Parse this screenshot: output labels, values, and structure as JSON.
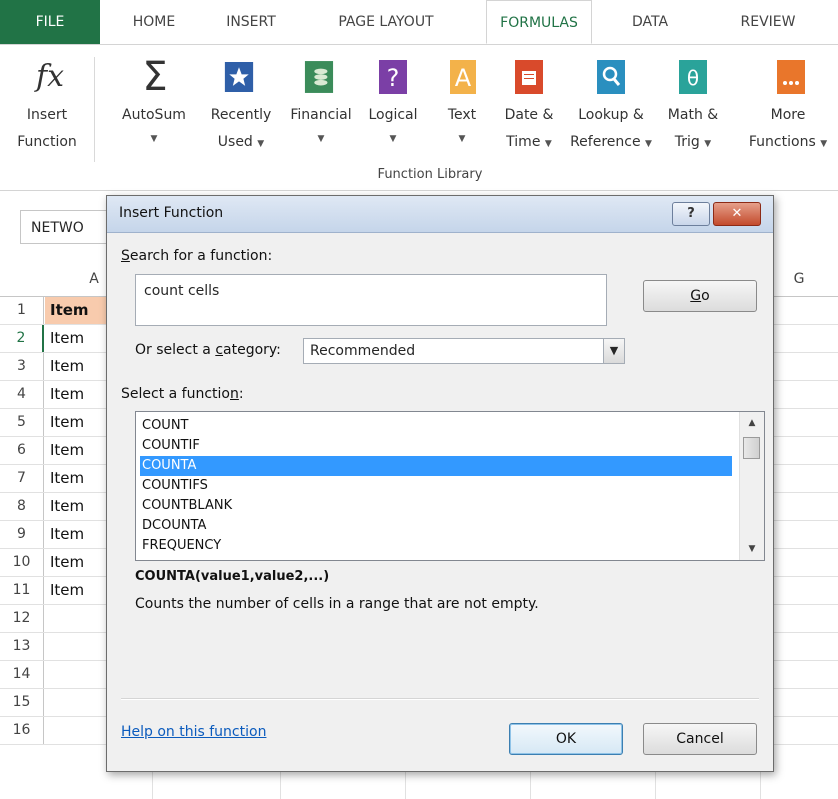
{
  "tabs": [
    "FILE",
    "HOME",
    "INSERT",
    "PAGE LAYOUT",
    "FORMULAS",
    "DATA",
    "REVIEW"
  ],
  "active_tab": "FORMULAS",
  "ribbon": {
    "insert_function": {
      "line1": "Insert",
      "line2": "Function"
    },
    "autosum": {
      "line1": "AutoSum"
    },
    "recently_used": {
      "line1": "Recently",
      "line2": "Used"
    },
    "financial": {
      "line1": "Financial"
    },
    "logical": {
      "line1": "Logical"
    },
    "text": {
      "line1": "Text"
    },
    "date_time": {
      "line1": "Date &",
      "line2": "Time"
    },
    "lookup": {
      "line1": "Lookup &",
      "line2": "Reference"
    },
    "math": {
      "line1": "Math &",
      "line2": "Trig"
    },
    "more": {
      "line1": "More",
      "line2": "Functions"
    },
    "group_label": "Function Library"
  },
  "name_box": "NETWO",
  "sheet": {
    "col_a": "A",
    "col_g": "G",
    "rows": [
      {
        "n": "1",
        "a": "Item"
      },
      {
        "n": "2",
        "a": "Item"
      },
      {
        "n": "3",
        "a": "Item"
      },
      {
        "n": "4",
        "a": "Item"
      },
      {
        "n": "5",
        "a": "Item"
      },
      {
        "n": "6",
        "a": "Item"
      },
      {
        "n": "7",
        "a": "Item"
      },
      {
        "n": "8",
        "a": "Item"
      },
      {
        "n": "9",
        "a": "Item"
      },
      {
        "n": "10",
        "a": "Item"
      },
      {
        "n": "11",
        "a": "Item"
      },
      {
        "n": "12",
        "a": ""
      },
      {
        "n": "13",
        "a": ""
      },
      {
        "n": "14",
        "a": ""
      },
      {
        "n": "15",
        "a": ""
      },
      {
        "n": "16",
        "a": ""
      }
    ]
  },
  "dialog": {
    "title": "Insert Function",
    "help_btn": "?",
    "close_btn": "✕",
    "search_label_pre": "",
    "search_label_key": "S",
    "search_label_rest": "earch for a function:",
    "search_value": "count cells",
    "go_key": "G",
    "go_rest": "o",
    "category_pre": "Or select a ",
    "category_key": "c",
    "category_rest": "ategory:",
    "category_value": "Recommended",
    "select_pre": "Select a functio",
    "select_key": "n",
    "select_rest": ":",
    "functions": [
      "COUNT",
      "COUNTIF",
      "COUNTA",
      "COUNTIFS",
      "COUNTBLANK",
      "DCOUNTA",
      "FREQUENCY"
    ],
    "selected_function": "COUNTA",
    "signature": "COUNTA(value1,value2,...)",
    "description": "Counts the number of cells in a range that are not empty.",
    "help_link": "Help on this function",
    "ok": "OK",
    "cancel": "Cancel"
  },
  "colors": {
    "excel_green": "#217346",
    "selection_blue": "#3399ff",
    "header_fill": "#f8cbad"
  }
}
